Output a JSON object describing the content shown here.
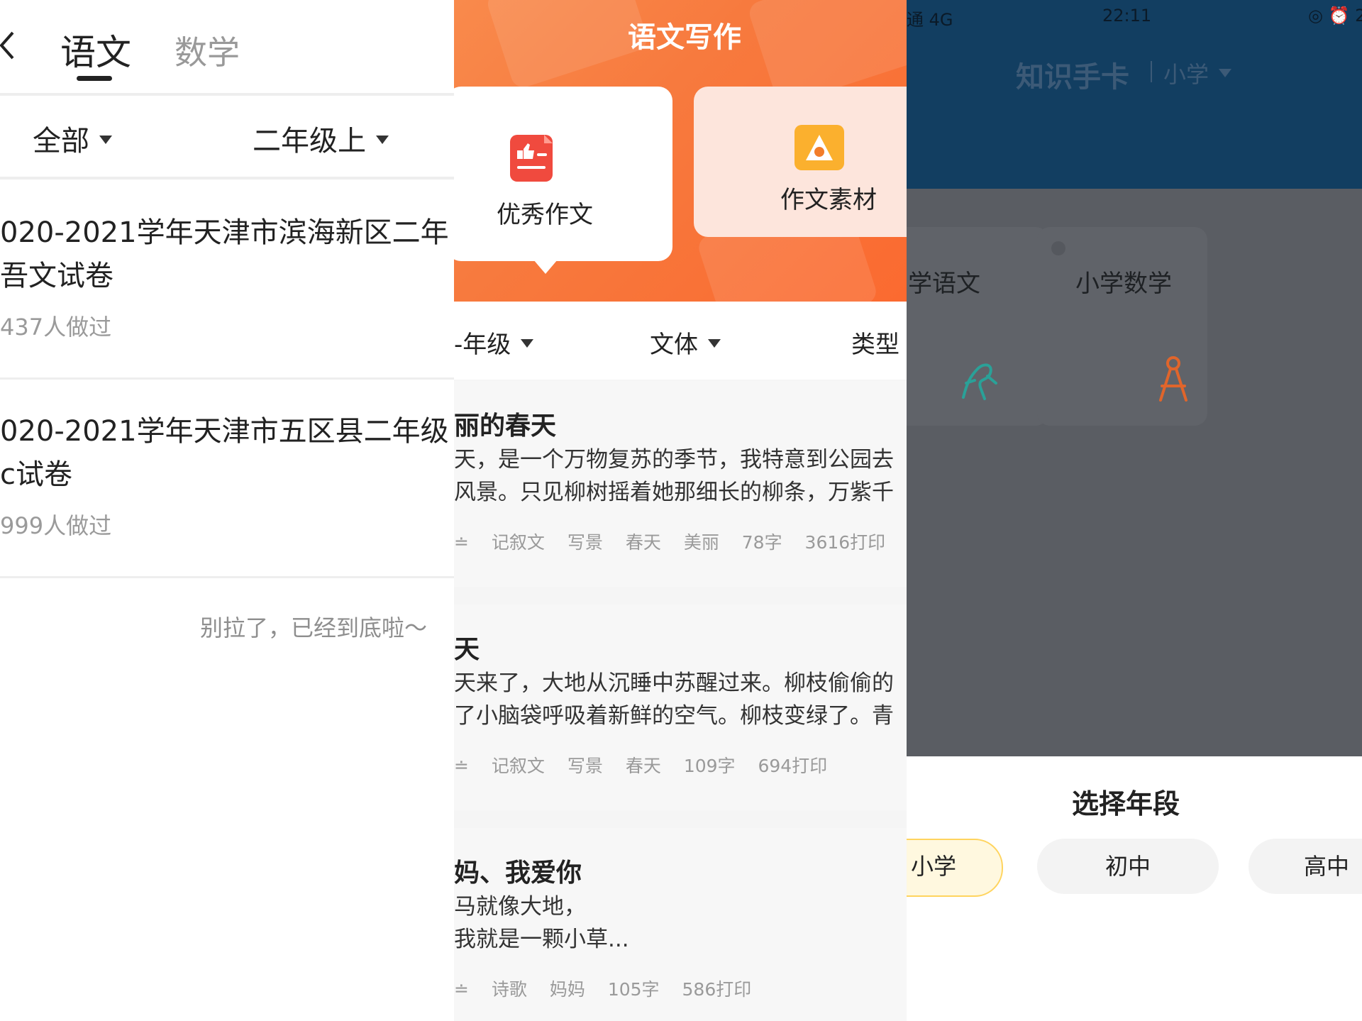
{
  "left_panel": {
    "back_icon": "chevron-left",
    "tabs": [
      {
        "label": "语文"
      },
      {
        "label": "数学"
      }
    ],
    "filters": [
      {
        "label": "全部"
      },
      {
        "label": "二年级上"
      }
    ],
    "exams": [
      {
        "title_line1": "020-2021学年天津市滨海新区二年",
        "title_line2": "吾文试卷",
        "attempts": "437人做过"
      },
      {
        "title_line1": "020-2021学年天津市五区县二年级",
        "title_line2": "c试卷",
        "attempts": "999人做过"
      }
    ],
    "end_text": "别拉了，已经到底啦～"
  },
  "middle_panel": {
    "header_title": "语文写作",
    "cards": [
      {
        "label": "优秀作文",
        "icon": "thumbs-up-doc-icon"
      },
      {
        "label": "作文素材",
        "icon": "triangle-material-icon"
      }
    ],
    "filters": [
      {
        "label": "-年级"
      },
      {
        "label": "文体"
      },
      {
        "label": "类型"
      }
    ],
    "essays": [
      {
        "title": "丽的春天",
        "line1": "天，是一个万物复苏的季节，我特意到公园去",
        "line2": "风景。只见柳树摇着她那细长的柳条，万紫千",
        "tags": [
          "≐",
          "记叙文",
          "写景",
          "春天",
          "美丽",
          "78字",
          "3616打印"
        ]
      },
      {
        "title": "天",
        "line1": "天来了，大地从沉睡中苏醒过来。柳枝偷偷的",
        "line2": "了小脑袋呼吸着新鲜的空气。柳枝变绿了。青",
        "tags": [
          "≐",
          "记叙文",
          "写景",
          "春天",
          "109字",
          "694打印"
        ]
      },
      {
        "title": "妈、我爱你",
        "line1": "马就像大地，",
        "line2": "我就是一颗小草...",
        "tags": [
          "≐",
          "诗歌",
          "妈妈",
          "105字",
          "586打印"
        ]
      }
    ]
  },
  "right_panel": {
    "status": {
      "carrier": "通  4G",
      "time": "22:11",
      "icons": "◎ ⏰ 2"
    },
    "title": "知识手卡",
    "level": "小学",
    "subjects": [
      {
        "label": "学语文",
        "icon": "chinese-figure-icon",
        "color": "#2aa198"
      },
      {
        "label": "小学数学",
        "icon": "compass-icon",
        "color": "#e0652b"
      }
    ],
    "sheet_title": "选择年段",
    "options": [
      {
        "label": "小学",
        "selected": true
      },
      {
        "label": "初中",
        "selected": false
      },
      {
        "label": "高中",
        "selected": false
      }
    ]
  },
  "colors": {
    "accent_orange": "#f97a3c",
    "selected_yellow": "#ffd45e",
    "dark_blue": "#123e61"
  }
}
